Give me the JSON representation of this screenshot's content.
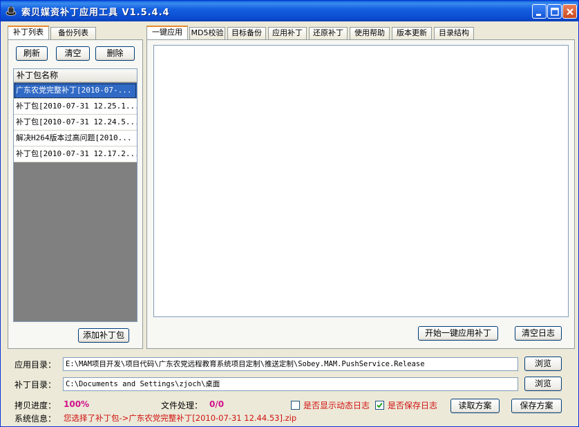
{
  "window": {
    "title": "索贝媒资补丁应用工具 V1.5.4.4"
  },
  "left": {
    "tabs": [
      {
        "label": "补丁列表",
        "active": true
      },
      {
        "label": "备份列表",
        "active": false
      }
    ],
    "buttons": {
      "refresh": "刷新",
      "clear": "清空",
      "delete": "删除",
      "add": "添加补丁包"
    },
    "list": {
      "header": "补丁包名称",
      "items": [
        {
          "label": "广东农党完整补丁[2010-07-...",
          "selected": true
        },
        {
          "label": "补丁包[2010-07-31 12.25.1...",
          "selected": false
        },
        {
          "label": "补丁包[2010-07-31 12.24.5...",
          "selected": false
        },
        {
          "label": "解决H264版本过高问题[2010...",
          "selected": false
        },
        {
          "label": "补丁包[2010-07-31 12.17.2...",
          "selected": false
        }
      ]
    }
  },
  "right": {
    "tabs": [
      {
        "label": "一键应用",
        "active": true
      },
      {
        "label": "MD5校验",
        "active": false
      },
      {
        "label": "目标备份",
        "active": false
      },
      {
        "label": "应用补丁",
        "active": false
      },
      {
        "label": "还原补丁",
        "active": false
      },
      {
        "label": "使用帮助",
        "active": false
      },
      {
        "label": "版本更新",
        "active": false
      },
      {
        "label": "目录结构",
        "active": false
      }
    ],
    "buttons": {
      "start": "开始一键应用补丁",
      "clear_log": "清空日志"
    }
  },
  "bottom": {
    "app_dir_label": "应用目录：",
    "app_dir_value": "E:\\MAM项目开发\\项目代码\\广东农党远程教育系统项目定制\\推送定制\\Sobey.MAM.PushService.Release",
    "patch_dir_label": "补丁目录：",
    "patch_dir_value": "C:\\Documents and Settings\\zjoch\\桌面",
    "browse": "浏览",
    "progress_label": "拷贝进度：",
    "progress_value": "100%",
    "file_label": "文件处理：",
    "file_value": "0/0",
    "show_log_label": "是否显示动态日志",
    "show_log_checked": false,
    "save_log_label": "是否保存日志",
    "save_log_checked": true,
    "read_scheme": "读取方案",
    "save_scheme": "保存方案",
    "sysinfo_label": "系统信息：",
    "sysinfo_value": "您选择了补丁包->广东农党完整补丁[2010-07-31 12.44.53].zip"
  },
  "colors": {
    "titlebar": "#0a4bd0",
    "selection": "#316ac5",
    "progress_text": "#d0108a",
    "alert_text": "#d01010",
    "window_bg": "#ece9d8"
  }
}
